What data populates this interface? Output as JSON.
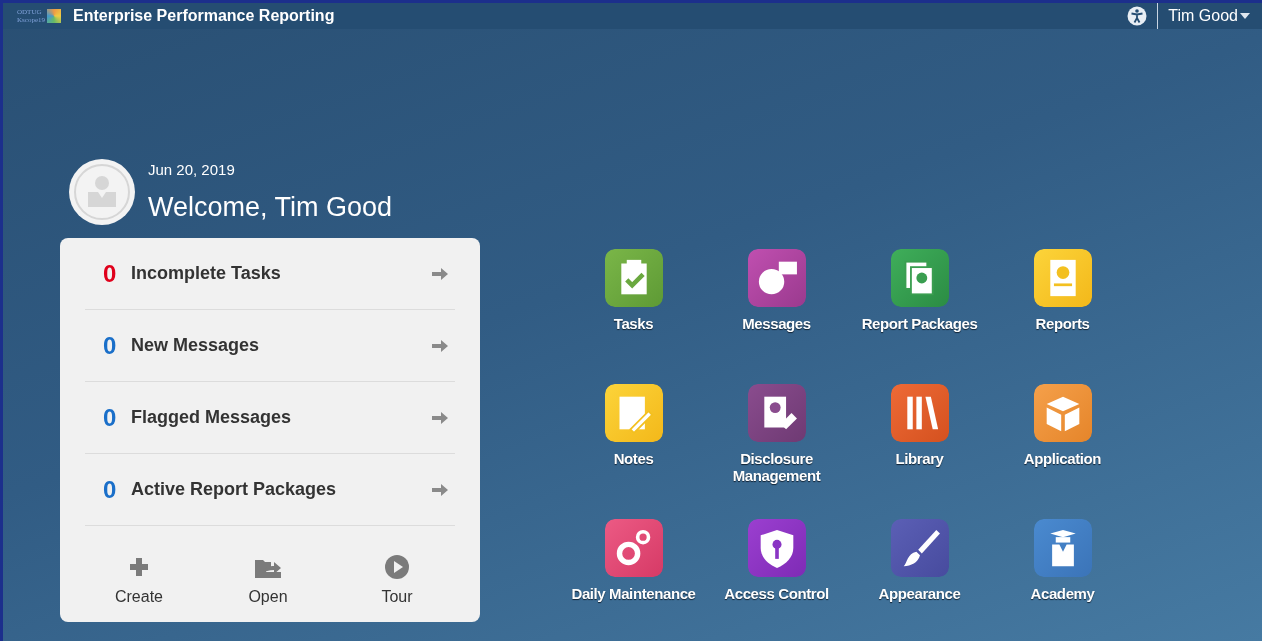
{
  "header": {
    "logo": [
      "ODTUG",
      "Kscope19"
    ],
    "title": "Enterprise Performance Reporting",
    "user": "Tim Good"
  },
  "welcome": {
    "date": "Jun 20, 2019",
    "greeting": "Welcome, Tim Good"
  },
  "summary": [
    {
      "count": "0",
      "label": "Incomplete Tasks",
      "color": "#e0001b"
    },
    {
      "count": "0",
      "label": "New Messages",
      "color": "#1a6fc9"
    },
    {
      "count": "0",
      "label": "Flagged Messages",
      "color": "#1a6fc9"
    },
    {
      "count": "0",
      "label": "Active Report Packages",
      "color": "#1a6fc9"
    }
  ],
  "actions": [
    {
      "kind": "create",
      "label": "Create"
    },
    {
      "kind": "open",
      "label": "Open"
    },
    {
      "kind": "tour",
      "label": "Tour"
    }
  ],
  "tiles": [
    {
      "kind": "tasks",
      "label": "Tasks"
    },
    {
      "kind": "messages",
      "label": "Messages"
    },
    {
      "kind": "packages",
      "label": "Report Packages"
    },
    {
      "kind": "reports",
      "label": "Reports"
    },
    {
      "kind": "notes",
      "label": "Notes"
    },
    {
      "kind": "disclosure",
      "label": "Disclosure Management"
    },
    {
      "kind": "library",
      "label": "Library"
    },
    {
      "kind": "application",
      "label": "Application"
    },
    {
      "kind": "maintenance",
      "label": "Daily Maintenance"
    },
    {
      "kind": "access",
      "label": "Access Control"
    },
    {
      "kind": "appearance",
      "label": "Appearance"
    },
    {
      "kind": "academy",
      "label": "Academy"
    }
  ]
}
